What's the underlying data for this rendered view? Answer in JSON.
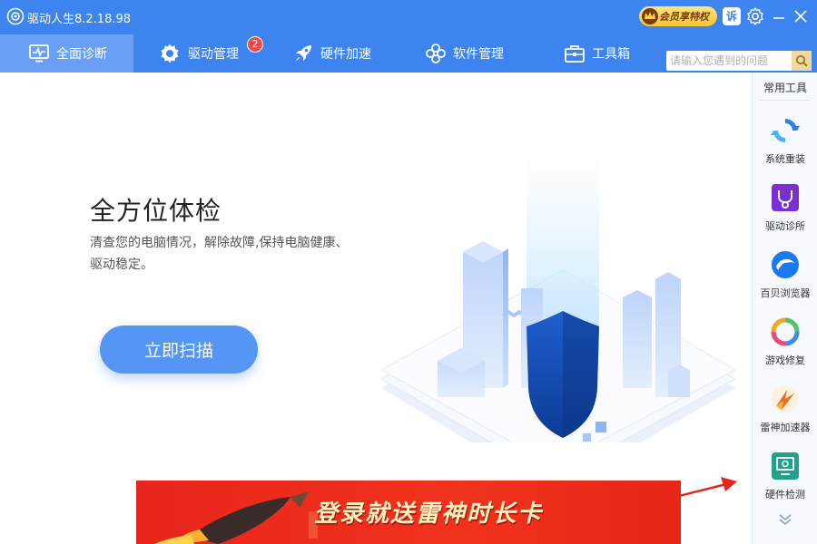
{
  "app": {
    "title": "驱动人生8.2.18.98",
    "vip_label": "会员享特权",
    "feedback_label": "诉"
  },
  "nav": {
    "tabs": [
      {
        "label": "全面诊断",
        "icon": "monitor-icon",
        "active": true
      },
      {
        "label": "驱动管理",
        "icon": "gear-icon",
        "badge": "2"
      },
      {
        "label": "硬件加速",
        "icon": "rocket-icon"
      },
      {
        "label": "软件管理",
        "icon": "flower-icon"
      },
      {
        "label": "工具箱",
        "icon": "toolbox-icon"
      }
    ],
    "search_placeholder": "请输入您遇到的问题"
  },
  "hero": {
    "title": "全方位体检",
    "description": "清查您的电脑情况，解除故障,保持电脑健康、驱动稳定。",
    "scan_button": "立即扫描"
  },
  "banner": {
    "text": "登录就送雷神时长卡"
  },
  "sidebar": {
    "title": "常用工具",
    "tools": [
      {
        "label": "系统重装",
        "icon": "system-reinstall-icon"
      },
      {
        "label": "驱动诊所",
        "icon": "driver-clinic-icon"
      },
      {
        "label": "百贝浏览器",
        "icon": "browser-icon"
      },
      {
        "label": "游戏修复",
        "icon": "game-repair-icon"
      },
      {
        "label": "雷神加速器",
        "icon": "leishen-accelerator-icon"
      },
      {
        "label": "硬件检测",
        "icon": "hardware-check-icon"
      }
    ]
  },
  "colors": {
    "primary": "#3e84f0",
    "active_tab": "#69a0f5",
    "scan_button": "#5595f3",
    "badge": "#f24a4a",
    "banner_red": "#e8251c"
  }
}
